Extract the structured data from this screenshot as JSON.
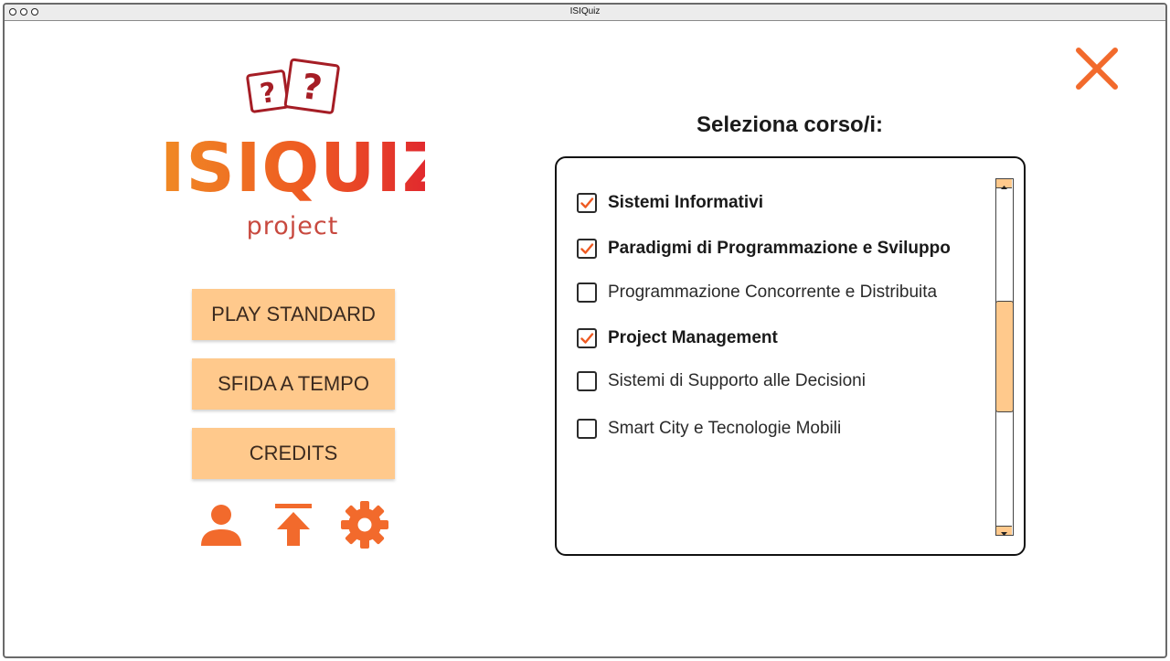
{
  "window": {
    "title": "ISIQuiz"
  },
  "logo": {
    "brand": "ISIQUIZ",
    "subtitle": "project",
    "dice_marks": [
      "?",
      "?"
    ]
  },
  "menu": {
    "play_standard": "PLAY STANDARD",
    "sfida_a_tempo": "SFIDA A TEMPO",
    "credits": "CREDITS"
  },
  "icons": {
    "profile": "user-icon",
    "upload": "upload-icon",
    "settings": "gear-icon",
    "close": "close-icon"
  },
  "course_panel": {
    "title": "Seleziona corso/i:",
    "courses": [
      {
        "label": "Sistemi Informativi",
        "checked": true
      },
      {
        "label": "Paradigmi di Programmazione e Sviluppo",
        "checked": true
      },
      {
        "label": "Programmazione Concorrente e Distribuita",
        "checked": false
      },
      {
        "label": "Project Management",
        "checked": true
      },
      {
        "label": "Sistemi di Supporto alle Decisioni",
        "checked": false
      },
      {
        "label": "Smart City e Tecnologie Mobili",
        "checked": false
      }
    ]
  },
  "colors": {
    "accent": "#f26a2c",
    "button_bg": "#ffc98c",
    "check": "#ee5a22"
  }
}
